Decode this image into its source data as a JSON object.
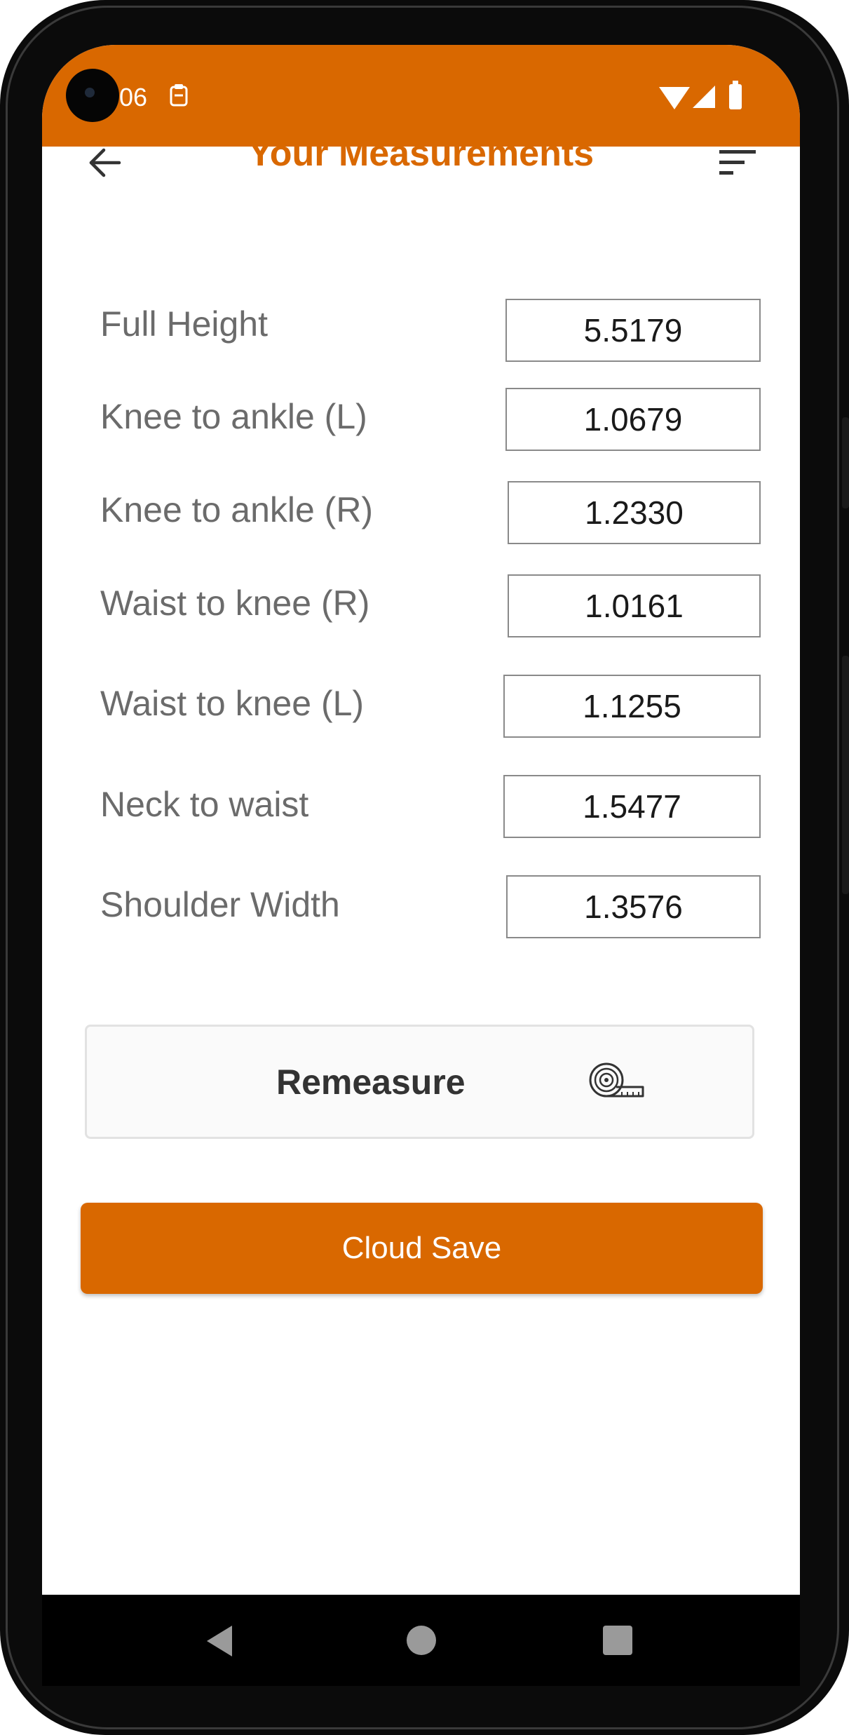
{
  "status_bar": {
    "time": "06",
    "left_icon": "clipboard-icon"
  },
  "header": {
    "title": "Your Measurements",
    "back_icon": "arrow-left-icon",
    "sort_icon": "sort-icon"
  },
  "measurements": [
    {
      "label": "Full Height",
      "value": "5.5179"
    },
    {
      "label": "Knee to ankle (L)",
      "value": "1.0679"
    },
    {
      "label": "Knee to ankle (R)",
      "value": "1.2330"
    },
    {
      "label": "Waist to knee (R)",
      "value": "1.0161"
    },
    {
      "label": "Waist to knee (L)",
      "value": "1.1255"
    },
    {
      "label": "Neck to waist",
      "value": "1.5477"
    },
    {
      "label": "Shoulder Width",
      "value": "1.3576"
    }
  ],
  "remeasure": {
    "label": "Remeasure",
    "icon": "measuring-tape-icon"
  },
  "cloud_save": {
    "label": "Cloud Save"
  },
  "colors": {
    "accent": "#d96800",
    "label": "#6b6b6b"
  }
}
